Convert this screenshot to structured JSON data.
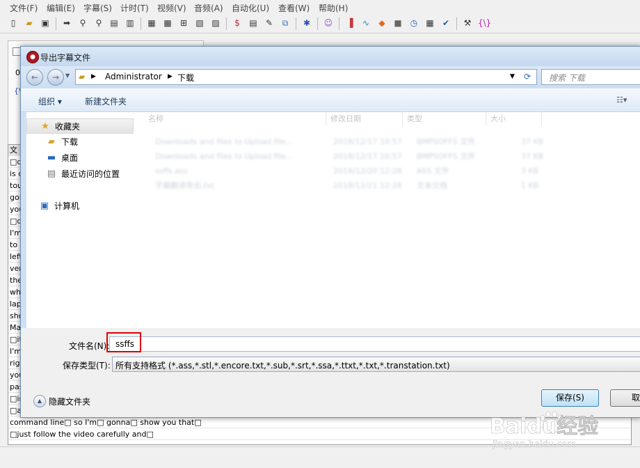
{
  "menu": [
    "文件(F)",
    "编辑(E)",
    "字幕(S)",
    "计时(T)",
    "视频(V)",
    "音频(A)",
    "自动化(U)",
    "查看(W)",
    "帮助(H)"
  ],
  "grid": {
    "header": "文",
    "rows": [
      "□d",
      "is d",
      "tou",
      "goi",
      "you",
      "□d",
      "I'm",
      "to s",
      "left",
      "ver",
      "the",
      "wh",
      "lap",
      "sho",
      "Ma",
      "□it",
      "I'm",
      "righ",
      "you",
      "pas",
      "□in",
      "□a",
      "command line□ so I'm□ gonna□ show you that□",
      "□just follow the video carefully and□"
    ]
  },
  "dialog": {
    "title": "导出字幕文件",
    "path": [
      "Administrator",
      "下载"
    ],
    "search_placeholder": "搜索 下载",
    "organize": "组织 ▾",
    "new_folder": "新建文件夹",
    "nav": {
      "favorites": "收藏夹",
      "downloads": "下载",
      "desktop": "桌面",
      "recent": "最近访问的位置",
      "computer": "计算机"
    },
    "columns": [
      "名称",
      "修改日期",
      "类型",
      "大小"
    ],
    "files": [
      [
        "Downloads and files to Upload file...",
        "2018/12/17 10:57",
        "BMPSOFFS 文件",
        "37 KB"
      ],
      [
        "Downloads and files to Upload file...",
        "2018/12/17 10:57",
        "BMPSOFFS 文件",
        "37 KB"
      ],
      [
        "ssffs.ass",
        "2018/12/20 12:28",
        "ASS 文件",
        "3 KB"
      ],
      [
        "字幕翻译导出.txt",
        "2018/12/21 12:28",
        "文本文档",
        "1 KB"
      ]
    ],
    "filename_label": "文件名(N):",
    "filename_value": "ssffs",
    "filetype_label": "保存类型(T):",
    "filetype_value": "所有支持格式 (*.ass,*.stl,*.encore.txt,*.sub,*.srt,*.ssa,*.ttxt,*.txt,*.transtation.txt)",
    "hide_folders": "隐藏文件夹",
    "save": "保存(S)",
    "cancel": "取"
  },
  "watermark": {
    "brand": "Baidu经验",
    "url": "jingyan.baidu.com"
  }
}
